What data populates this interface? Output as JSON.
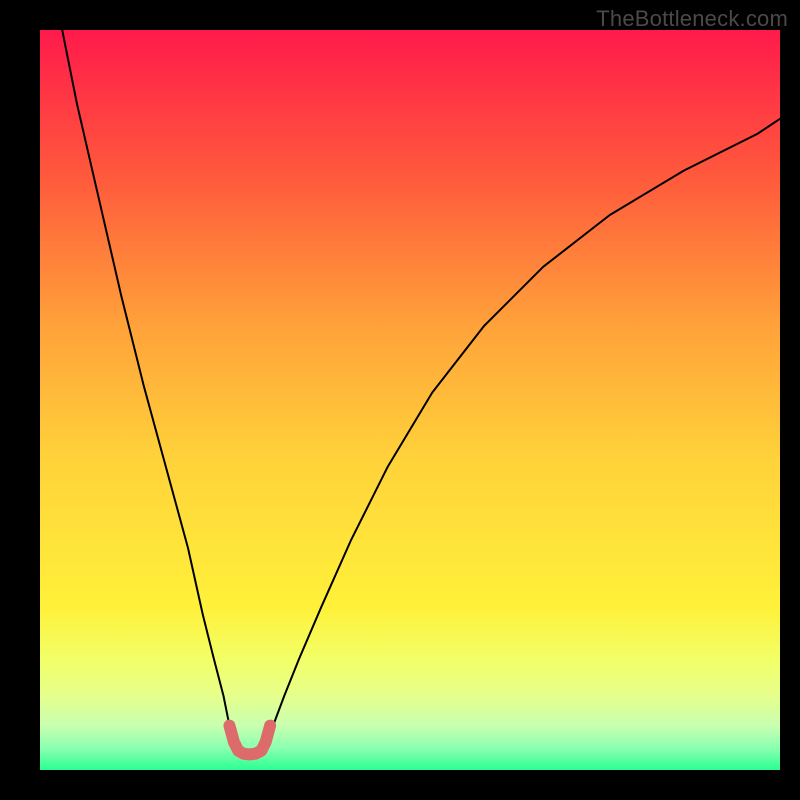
{
  "watermark": "TheBottleneck.com",
  "chart_data": {
    "type": "line",
    "title": "",
    "xlabel": "",
    "ylabel": "",
    "xlim": [
      0,
      100
    ],
    "ylim": [
      0,
      100
    ],
    "grid": false,
    "legend": false,
    "annotations": [],
    "gradient_stops": [
      {
        "pos": 0.0,
        "color": "#ff1a4b"
      },
      {
        "pos": 0.2,
        "color": "#ff5a3c"
      },
      {
        "pos": 0.4,
        "color": "#ffa23a"
      },
      {
        "pos": 0.58,
        "color": "#ffd23a"
      },
      {
        "pos": 0.78,
        "color": "#fff13a"
      },
      {
        "pos": 0.85,
        "color": "#f2ff66"
      },
      {
        "pos": 0.9,
        "color": "#e6ff8c"
      },
      {
        "pos": 0.94,
        "color": "#c8ffb0"
      },
      {
        "pos": 0.97,
        "color": "#8cffb0"
      },
      {
        "pos": 1.0,
        "color": "#2bff93"
      }
    ],
    "series": [
      {
        "name": "left-branch",
        "color": "#000000",
        "width": 2,
        "x": [
          3,
          5,
          8,
          11,
          14,
          17,
          20,
          22,
          23.5,
          24.8,
          25.6,
          26.2
        ],
        "y": [
          100,
          90,
          77,
          64,
          52,
          41,
          30,
          21,
          15,
          10,
          6,
          3.5
        ]
      },
      {
        "name": "right-branch",
        "color": "#000000",
        "width": 2,
        "x": [
          30.5,
          31.5,
          33,
          35,
          38,
          42,
          47,
          53,
          60,
          68,
          77,
          87,
          97,
          100
        ],
        "y": [
          3.5,
          6,
          10,
          15,
          22,
          31,
          41,
          51,
          60,
          68,
          75,
          81,
          86,
          88
        ]
      },
      {
        "name": "trough",
        "color": "#dd6b6b",
        "width": 12,
        "x": [
          25.6,
          26.2,
          26.8,
          27.5,
          28.3,
          29.1,
          29.9,
          30.5,
          31.1
        ],
        "y": [
          6.0,
          3.8,
          2.6,
          2.2,
          2.1,
          2.2,
          2.6,
          3.8,
          6.0
        ]
      }
    ]
  }
}
